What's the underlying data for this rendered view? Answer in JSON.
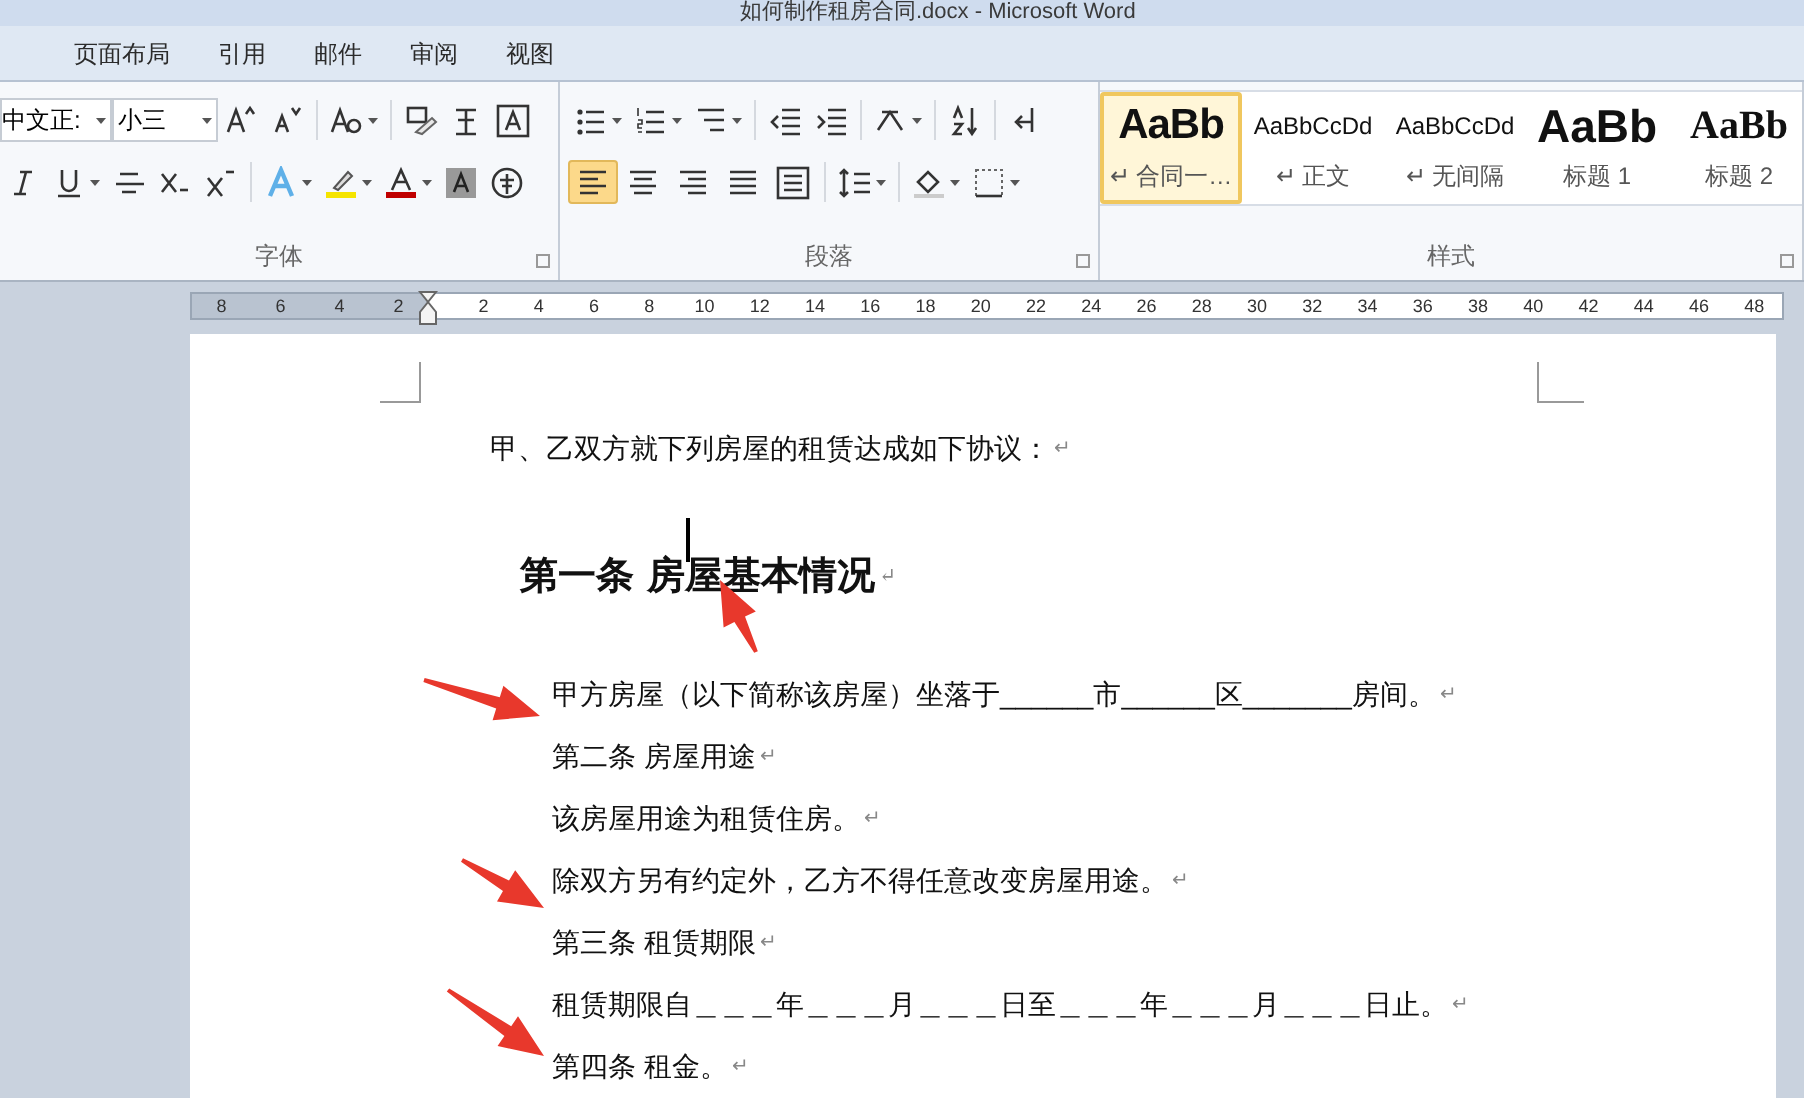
{
  "window": {
    "title": "如何制作租房合同.docx - Microsoft Word"
  },
  "menu_tabs": [
    "页面布局",
    "引用",
    "邮件",
    "审阅",
    "视图"
  ],
  "font_group": {
    "font_name": "中文正:",
    "font_size": "小三",
    "label": "字体"
  },
  "paragraph_group": {
    "label": "段落",
    "align_buttons": [
      {
        "selected": true
      },
      {
        "selected": false
      },
      {
        "selected": false
      },
      {
        "selected": false
      },
      {
        "selected": false
      }
    ]
  },
  "styles_group": {
    "label": "样式",
    "styles": [
      {
        "preview": "AaBb",
        "name": "↵ 合同一…",
        "kind": "bold-sans",
        "selected": true
      },
      {
        "preview": "AaBbCcDd",
        "name": "↵ 正文",
        "kind": "normal",
        "selected": false
      },
      {
        "preview": "AaBbCcDd",
        "name": "↵ 无间隔",
        "kind": "normal",
        "selected": false
      },
      {
        "preview": "AaBb",
        "name": "标题 1",
        "kind": "large-sans",
        "selected": false
      },
      {
        "preview": "AaBb",
        "name": "标题 2",
        "kind": "large-serif",
        "selected": false
      }
    ]
  },
  "ruler": {
    "left_ticks": [
      "8",
      "6",
      "4",
      "2"
    ],
    "right_ticks": [
      "2",
      "4",
      "6",
      "8",
      "10",
      "12",
      "14",
      "16",
      "18",
      "20",
      "22",
      "24",
      "26",
      "28",
      "30",
      "32",
      "34",
      "36",
      "38",
      "40",
      "42",
      "44",
      "46",
      "48"
    ]
  },
  "document": {
    "paragraphs": [
      {
        "kind": "body",
        "text": "甲、乙双方就下列房屋的租赁达成如下协议：",
        "mark": "↵"
      },
      {
        "kind": "heading",
        "text": "第一条 房屋基本情况",
        "mark": "↵"
      },
      {
        "kind": "indented",
        "text": "甲方房屋（以下简称该房屋）坐落于______市______区_______房间。",
        "mark": "↵"
      },
      {
        "kind": "indented",
        "text": "第二条 房屋用途",
        "mark": "↵"
      },
      {
        "kind": "indented",
        "text": "该房屋用途为租赁住房。",
        "mark": "↵"
      },
      {
        "kind": "indented",
        "text": "除双方另有约定外，乙方不得任意改变房屋用途。",
        "mark": "↵"
      },
      {
        "kind": "indented",
        "text": "第三条 租赁期限",
        "mark": "↵"
      },
      {
        "kind": "indented",
        "text": "租赁期限自＿＿＿年＿＿＿月＿＿＿日至＿＿＿年＿＿＿月＿＿＿日止。",
        "mark": "↵"
      },
      {
        "kind": "indented",
        "text": "第四条 租金。",
        "mark": "↵"
      }
    ]
  }
}
